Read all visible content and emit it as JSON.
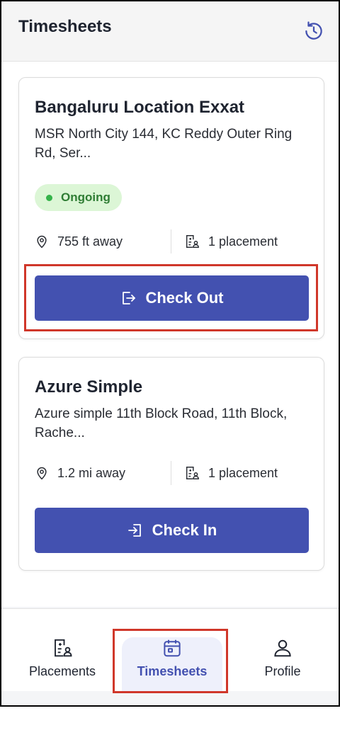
{
  "header": {
    "title": "Timesheets",
    "history_icon": "history-icon"
  },
  "cards": [
    {
      "name": "Bangaluru Location Exxat",
      "address": "MSR North City 144, KC Reddy Outer Ring Rd, Ser...",
      "status": "Ongoing",
      "distance": "755 ft away",
      "placements": "1 placement",
      "action": "Check Out"
    },
    {
      "name": "Azure Simple",
      "address": "Azure simple 11th Block Road, 11th Block, Rache...",
      "distance": "1.2 mi away",
      "placements": "1 placement",
      "action": "Check In"
    }
  ],
  "nav": {
    "items": [
      {
        "label": "Placements",
        "icon": "placements-icon"
      },
      {
        "label": "Timesheets",
        "icon": "calendar-icon",
        "active": true
      },
      {
        "label": "Profile",
        "icon": "user-icon"
      }
    ]
  },
  "colors": {
    "primary": "#4351b0",
    "ongoing_bg": "#dcf6d6",
    "ongoing_dot": "#35b34a",
    "highlight": "#d0372a"
  }
}
